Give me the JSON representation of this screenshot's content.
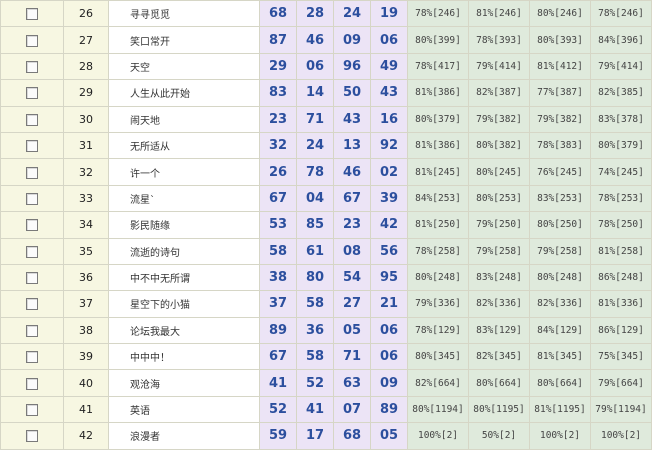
{
  "rows": [
    {
      "num": "26",
      "name": "寻寻觅觅",
      "codes": [
        "68",
        "28",
        "24",
        "19"
      ],
      "stats": [
        "78%[246]",
        "81%[246]",
        "80%[246]",
        "78%[246]"
      ]
    },
    {
      "num": "27",
      "name": "笑口常开",
      "codes": [
        "87",
        "46",
        "09",
        "06"
      ],
      "stats": [
        "80%[399]",
        "78%[393]",
        "80%[393]",
        "84%[396]"
      ]
    },
    {
      "num": "28",
      "name": "天空",
      "codes": [
        "29",
        "06",
        "96",
        "49"
      ],
      "stats": [
        "78%[417]",
        "79%[414]",
        "81%[412]",
        "79%[414]"
      ]
    },
    {
      "num": "29",
      "name": "人生从此开始",
      "codes": [
        "83",
        "14",
        "50",
        "43"
      ],
      "stats": [
        "81%[386]",
        "82%[387]",
        "77%[387]",
        "82%[385]"
      ]
    },
    {
      "num": "30",
      "name": "闹天地",
      "codes": [
        "23",
        "71",
        "43",
        "16"
      ],
      "stats": [
        "80%[379]",
        "79%[382]",
        "79%[382]",
        "83%[378]"
      ]
    },
    {
      "num": "31",
      "name": "无所适从",
      "codes": [
        "32",
        "24",
        "13",
        "92"
      ],
      "stats": [
        "81%[386]",
        "80%[382]",
        "78%[383]",
        "80%[379]"
      ]
    },
    {
      "num": "32",
      "name": "许一个",
      "codes": [
        "26",
        "78",
        "46",
        "02"
      ],
      "stats": [
        "81%[245]",
        "80%[245]",
        "76%[245]",
        "74%[245]"
      ]
    },
    {
      "num": "33",
      "name": "流星`",
      "codes": [
        "67",
        "04",
        "67",
        "39"
      ],
      "stats": [
        "84%[253]",
        "80%[253]",
        "83%[253]",
        "78%[253]"
      ]
    },
    {
      "num": "34",
      "name": "影民随缘",
      "codes": [
        "53",
        "85",
        "23",
        "42"
      ],
      "stats": [
        "81%[250]",
        "79%[250]",
        "80%[250]",
        "78%[250]"
      ]
    },
    {
      "num": "35",
      "name": "流逝的诗句",
      "codes": [
        "58",
        "61",
        "08",
        "56"
      ],
      "stats": [
        "78%[258]",
        "79%[258]",
        "79%[258]",
        "81%[258]"
      ]
    },
    {
      "num": "36",
      "name": "中不中无所谓",
      "codes": [
        "38",
        "80",
        "54",
        "95"
      ],
      "stats": [
        "80%[248]",
        "83%[248]",
        "80%[248]",
        "86%[248]"
      ]
    },
    {
      "num": "37",
      "name": "星空下的小猫",
      "codes": [
        "37",
        "58",
        "27",
        "21"
      ],
      "stats": [
        "79%[336]",
        "82%[336]",
        "82%[336]",
        "81%[336]"
      ]
    },
    {
      "num": "38",
      "name": "论坛我最大",
      "codes": [
        "89",
        "36",
        "05",
        "06"
      ],
      "stats": [
        "78%[129]",
        "83%[129]",
        "84%[129]",
        "86%[129]"
      ]
    },
    {
      "num": "39",
      "name": "中中中！",
      "codes": [
        "67",
        "58",
        "71",
        "06"
      ],
      "stats": [
        "80%[345]",
        "82%[345]",
        "81%[345]",
        "75%[345]"
      ]
    },
    {
      "num": "40",
      "name": "观沧海",
      "codes": [
        "41",
        "52",
        "63",
        "09"
      ],
      "stats": [
        "82%[664]",
        "80%[664]",
        "80%[664]",
        "79%[664]"
      ]
    },
    {
      "num": "41",
      "name": "英语",
      "codes": [
        "52",
        "41",
        "07",
        "89"
      ],
      "stats": [
        "80%[1194]",
        "80%[1195]",
        "81%[1195]",
        "79%[1194]"
      ]
    },
    {
      "num": "42",
      "name": "浪漫者",
      "codes": [
        "59",
        "17",
        "68",
        "05"
      ],
      "stats": [
        "100%[2]",
        "50%[2]",
        "100%[2]",
        "100%[2]"
      ]
    }
  ]
}
